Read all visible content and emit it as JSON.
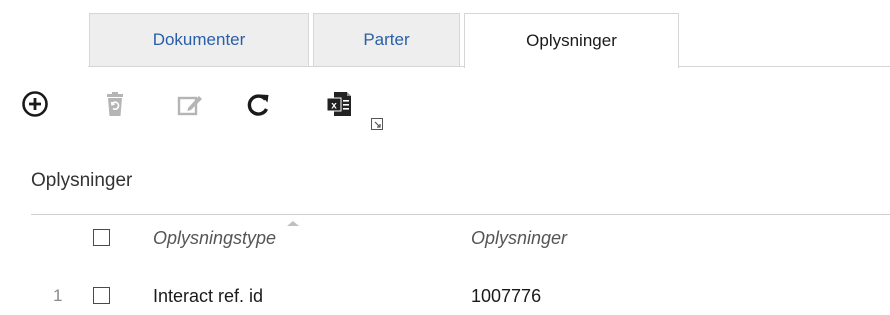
{
  "tabs": [
    {
      "label": "Dokumenter",
      "active": false
    },
    {
      "label": "Parter",
      "active": false
    },
    {
      "label": "Oplysninger",
      "active": true
    }
  ],
  "toolbar": {
    "icons": [
      "add-circle-icon",
      "delete-recycle-icon",
      "edit-icon",
      "refresh-icon",
      "excel-export-icon"
    ],
    "accent_color": "#1a1a1a",
    "disabled_color": "#b5b5b5",
    "excel_color": "#222222"
  },
  "section": {
    "title": "Oplysninger"
  },
  "table": {
    "columns": [
      "Oplysningstype",
      "Oplysninger"
    ],
    "sorted_column": "Oplysningstype",
    "rows": [
      {
        "num": "1",
        "type": "Interact ref. id",
        "value": "1007776",
        "checked": false
      }
    ]
  },
  "colors": {
    "tab_link": "#2a5fa8",
    "tab_inactive_bg": "#eeeeee",
    "border": "#d6d6d6"
  }
}
